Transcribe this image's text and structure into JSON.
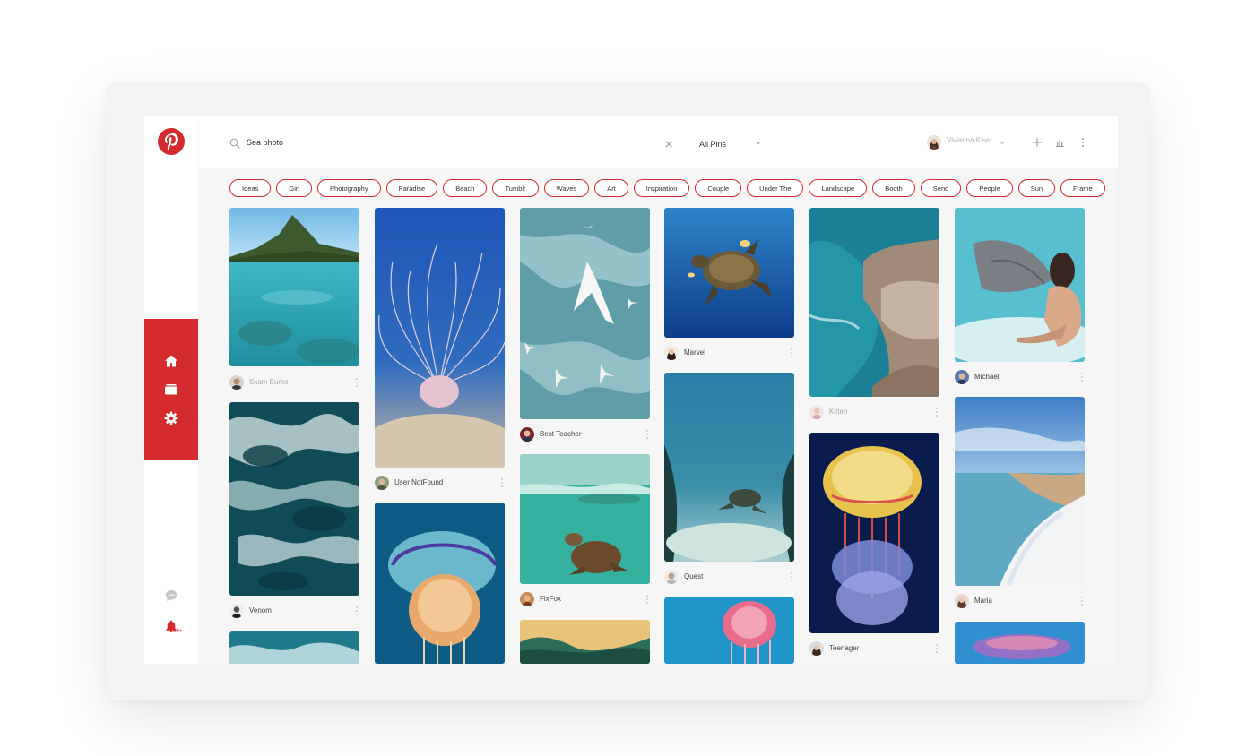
{
  "search": {
    "value": "Sea photo"
  },
  "filter": {
    "selected": "All Pins"
  },
  "user": {
    "name": "Vivianna Kiser"
  },
  "notifications": {
    "badge": "99+"
  },
  "tags": [
    "Ideas",
    "Girl",
    "Photography",
    "Paradise",
    "Beach",
    "Tumblr",
    "Waves",
    "Art",
    "Inspiration",
    "Couple",
    "Under The",
    "Landscape",
    "Booth",
    "Send",
    "People",
    "Sun",
    "Frame"
  ],
  "pins": {
    "p1": "Skam Burko",
    "p2": "Venom",
    "p4": "User NotFound",
    "p6": "Best Teacher",
    "p7": "FixFox",
    "p9": "Marvel",
    "p10": "Quest",
    "p12": "Kitten",
    "p13": "Teenager",
    "p14": "Michael",
    "p15": "Maria"
  },
  "colors": {
    "brand": "#d42b2f"
  },
  "icons": [
    "pinterest-logo",
    "home-icon",
    "boards-icon",
    "settings-icon",
    "chat-icon",
    "bell-icon",
    "search-icon",
    "close-icon",
    "chevron-down-icon",
    "plus-icon",
    "bar-chart-icon",
    "more-vertical-icon"
  ]
}
